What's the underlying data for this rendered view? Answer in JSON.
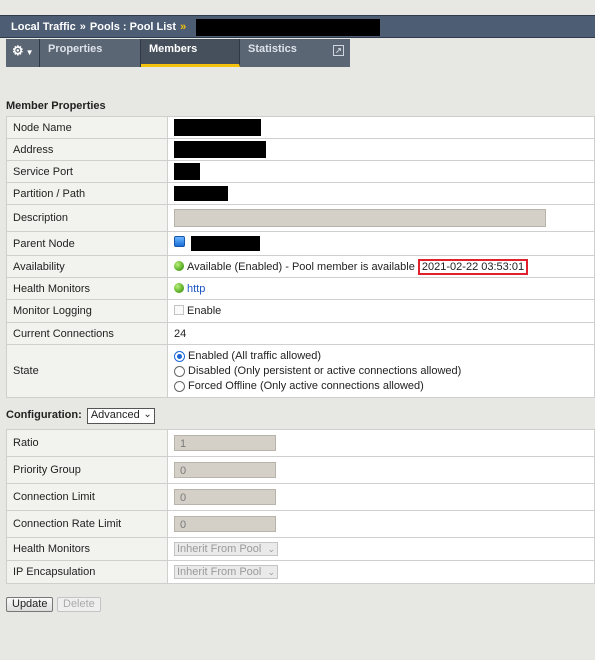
{
  "breadcrumb": {
    "part1": "Local Traffic",
    "part2": "Pools : Pool List",
    "sep": "»"
  },
  "tabs": {
    "properties": "Properties",
    "members": "Members",
    "statistics": "Statistics"
  },
  "member_properties": {
    "title": "Member Properties",
    "labels": {
      "node_name": "Node Name",
      "address": "Address",
      "service_port": "Service Port",
      "partition": "Partition / Path",
      "description": "Description",
      "parent_node": "Parent Node",
      "availability": "Availability",
      "health_monitors": "Health Monitors",
      "monitor_logging": "Monitor Logging",
      "current_connections": "Current Connections",
      "state": "State"
    },
    "availability_text": "Available (Enabled) - Pool member is available",
    "availability_time": "2021-02-22 03:53:01",
    "health_monitor_link": "http",
    "monitor_logging_label": "Enable",
    "current_connections": "24",
    "state_options": [
      "Enabled (All traffic allowed)",
      "Disabled (Only persistent or active connections allowed)",
      "Forced Offline (Only active connections allowed)"
    ]
  },
  "configuration": {
    "title": "Configuration:",
    "mode": "Advanced",
    "labels": {
      "ratio": "Ratio",
      "priority_group": "Priority Group",
      "connection_limit": "Connection Limit",
      "connection_rate_limit": "Connection Rate Limit",
      "health_monitors": "Health Monitors",
      "ip_encapsulation": "IP Encapsulation"
    },
    "values": {
      "ratio": "1",
      "priority_group": "0",
      "connection_limit": "0",
      "connection_rate_limit": "0"
    },
    "inherit_label": "Inherit From Pool"
  },
  "buttons": {
    "update": "Update",
    "delete": "Delete"
  },
  "icons": {
    "settings": "gear-icon",
    "status": "green-status-icon",
    "node": "node-icon",
    "external": "popout-icon"
  },
  "colors": {
    "header_bg": "#4d5d73",
    "accent": "#f4c20d",
    "highlight_box": "#e0202a"
  }
}
